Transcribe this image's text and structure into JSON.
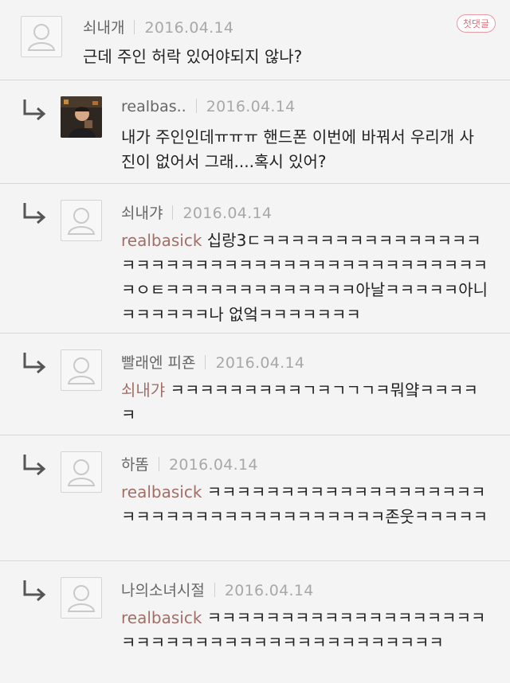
{
  "comments": [
    {
      "name": "쇠내개",
      "date": "2016.04.14",
      "badge": "첫댓글",
      "mention": "",
      "text": "근데 주인 허락 있어야되지 않나?"
    },
    {
      "name": "realbas..",
      "date": "2016.04.14",
      "mention": "",
      "text": "내가 주인인데ㅠㅠㅠ 핸드폰 이번에 바꿔서 우리개 사진이 없어서 그래....혹시 있어?"
    },
    {
      "name": "쇠내갸",
      "date": "2016.04.14",
      "mention": "realbasick",
      "text": " 십랑3ㄷㅋㅋㅋㅋㅋㅋㅋㅋㅋㅋㅋㅋㅋㅋㅋㅋㅋㅋㅋㅋㅋㅋㅋㅋㅋㅋㅋㅋㅋㅋㅋㅋㅋㅋㅋㅋㅋㅋㅋㅋㅋㅇㅌㅋㅋㅋㅋㅋㅋㅋㅋㅋㅋㅋㅋㅋ아날ㅋㅋㅋㅋㅋ아니 ㅋㅋㅋㅋㅋㅋ나 없엌ㅋㅋㅋㅋㅋㅋㅋ"
    },
    {
      "name": "빨래엔 피죤",
      "date": "2016.04.14",
      "mention": "쇠내갸",
      "text": " ㅋㅋㅋㅋㅋㅋㅋㅋㅋㄱㅋㄱㄱㄱㅋ뭐얔ㅋㅋㅋㅋㅋ"
    },
    {
      "name": "하똠",
      "date": "2016.04.14",
      "mention": "realbasick",
      "text": " ㅋㅋㅋㅋㅋㅋㅋㅋㅋㅋㅋㅋㅋㅋㅋㅋㅋㅋㅋㅋㅋㅋㅋㅋㅋㅋㅋㅋㅋㅋㅋㅋㅋㅋㅋㅋㅋ존웃ㅋㅋㅋㅋㅋ"
    },
    {
      "name": "나의소녀시절",
      "date": "2016.04.14",
      "mention": "realbasick",
      "text": " ㅋㅋㅋㅋㅋㅋㅋㅋㅋㅋㅋㅋㅋㅋㅋㅋㅋㅋㅋㅋㅋㅋㅋㅋㅋㅋㅋㅋㅋㅋㅋㅋㅋㅋㅋㅋㅋㅋㅋㅋㅋ"
    }
  ]
}
